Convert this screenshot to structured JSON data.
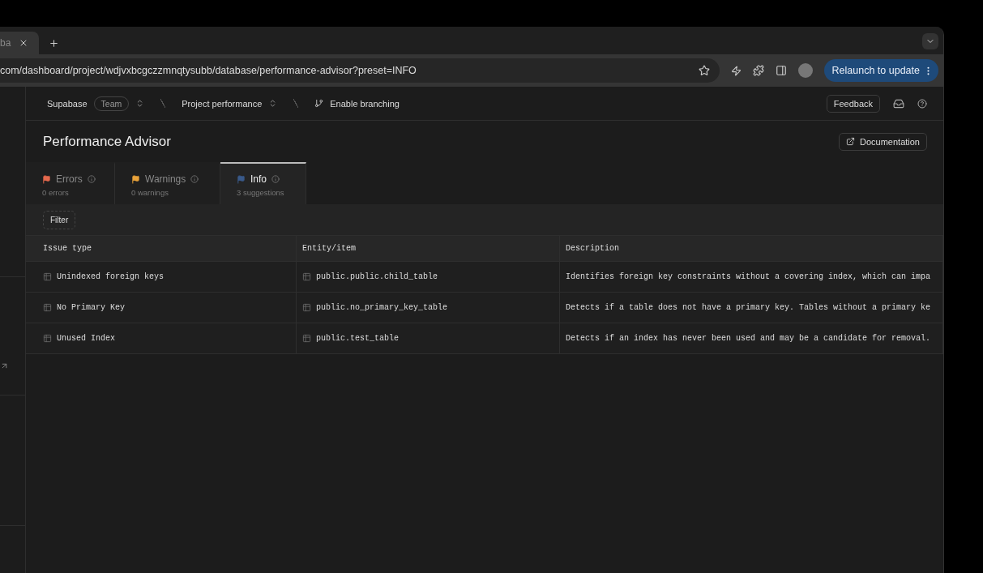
{
  "browser": {
    "tab_title": "ba",
    "url": "com/dashboard/project/wdjvxbcgczzmnqtysubb/database/performance-advisor?preset=INFO",
    "relaunch": "Relaunch to update"
  },
  "header": {
    "org": "Supabase",
    "plan": "Team",
    "project": "Project performance",
    "branching": "Enable branching",
    "feedback": "Feedback"
  },
  "page": {
    "title": "Performance Advisor",
    "documentation": "Documentation"
  },
  "tabs": [
    {
      "kind": "error",
      "label": "Errors",
      "count": "0 errors",
      "selected": false
    },
    {
      "kind": "warning",
      "label": "Warnings",
      "count": "0 warnings",
      "selected": false
    },
    {
      "kind": "info",
      "label": "Info",
      "count": "3 suggestions",
      "selected": true
    }
  ],
  "filter": "Filter",
  "table": {
    "columns": [
      "Issue type",
      "Entity/item",
      "Description"
    ],
    "rows": [
      {
        "issue": "Unindexed foreign keys",
        "entity": "public.public.child_table",
        "description": "Identifies foreign key constraints without a covering index, which can impa"
      },
      {
        "issue": "No Primary Key",
        "entity": "public.no_primary_key_table",
        "description": "Detects if a table does not have a primary key. Tables without a primary ke"
      },
      {
        "issue": "Unused Index",
        "entity": "public.test_table",
        "description": "Detects if an index has never been used and may be a candidate for removal."
      }
    ]
  }
}
